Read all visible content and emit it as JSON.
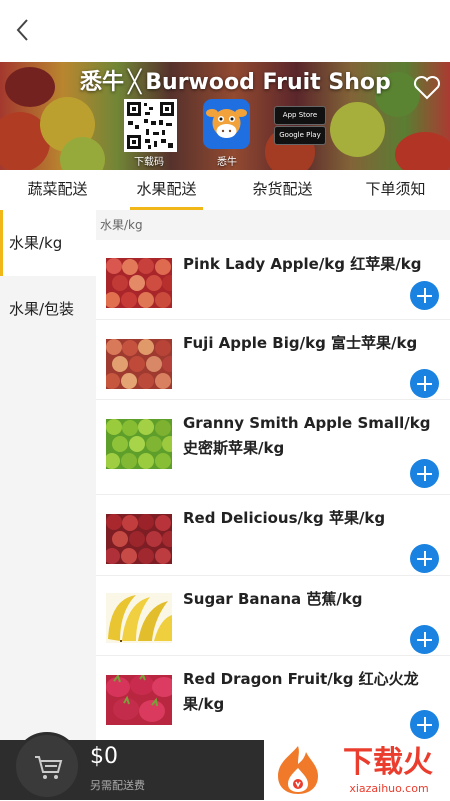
{
  "header": {
    "back_label": "<"
  },
  "banner": {
    "brand": "悉牛",
    "separator": "╳",
    "shop": "Burwood Fruit Shop",
    "qr_label": "下载码",
    "app_label": "悉牛",
    "app_store": "App Store",
    "google_play": "Google Play"
  },
  "tabs": [
    "蔬菜配送",
    "水果配送",
    "杂货配送",
    "下单须知"
  ],
  "active_tab": "水果配送",
  "sidebar": {
    "items": [
      "水果/kg",
      "水果/包装"
    ],
    "active": "水果/kg"
  },
  "section_title": "水果/kg",
  "products": [
    {
      "name": "Pink Lady Apple/kg 红苹果/kg",
      "fruit": "red-apples"
    },
    {
      "name": "Fuji Apple Big/kg 富士苹果/kg",
      "fruit": "fuji-apples"
    },
    {
      "name": "Granny Smith Apple Small/kg 史密斯苹果/kg",
      "fruit": "green-apples"
    },
    {
      "name": "Red Delicious/kg 苹果/kg",
      "fruit": "red-delicious"
    },
    {
      "name": "Sugar Banana 芭蕉/kg",
      "fruit": "bananas"
    },
    {
      "name": "Red Dragon Fruit/kg 红心火龙果/kg",
      "fruit": "dragon-fruit"
    }
  ],
  "cart": {
    "total": "$0",
    "delivery_note": "另需配送费"
  },
  "watermark": {
    "text": "下载火",
    "url": "xiazaihuo.com"
  },
  "colors": {
    "accent": "#f1b718",
    "add_button": "#1a82e0",
    "bottom_bar": "#2d2d2d",
    "watermark": "#ea3d2e"
  }
}
